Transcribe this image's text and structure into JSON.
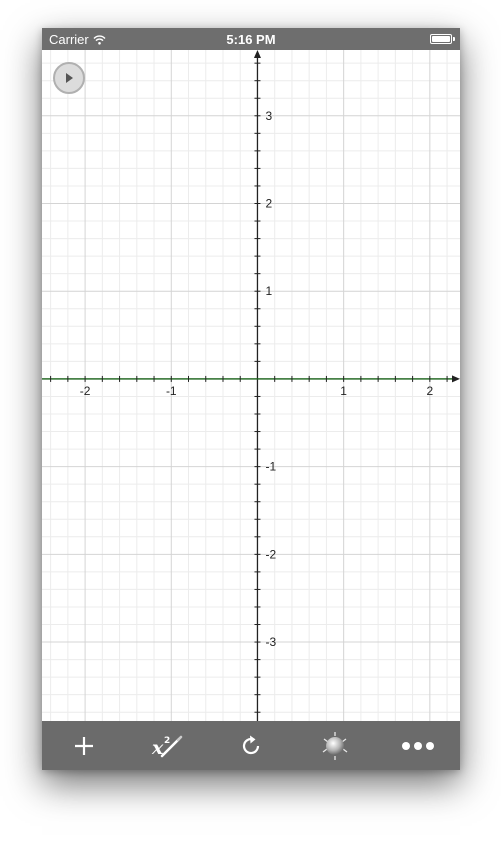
{
  "status_bar": {
    "carrier": "Carrier",
    "time": "5:16 PM",
    "wifi_icon": "wifi-icon",
    "battery_icon": "battery-icon"
  },
  "graph": {
    "x_ticks": [
      "-2",
      "-1",
      "1",
      "2"
    ],
    "y_ticks": [
      "3",
      "2",
      "1",
      "-1",
      "-2",
      "-3"
    ],
    "x_range": [
      -2.5,
      2.35
    ],
    "y_range": [
      -3.9,
      3.75
    ],
    "grid": true,
    "plotted_line": "y = 0",
    "line_color": "#1f7a1f"
  },
  "play_button": {
    "icon": "play-icon"
  },
  "toolbar": {
    "add_icon": "plus-icon",
    "formula_icon": "x-squared-edit-icon",
    "formula_glyph": "x",
    "formula_sup": "2",
    "reset_icon": "refresh-icon",
    "trace_icon": "trace-ball-icon",
    "more_icon": "more-dots-icon"
  },
  "colors": {
    "status_bg": "#6e6e6e",
    "toolbar_bg": "#6b6b6b",
    "axis": "#222222",
    "grid_major": "#d4d4d4",
    "grid_minor": "#ececec"
  }
}
